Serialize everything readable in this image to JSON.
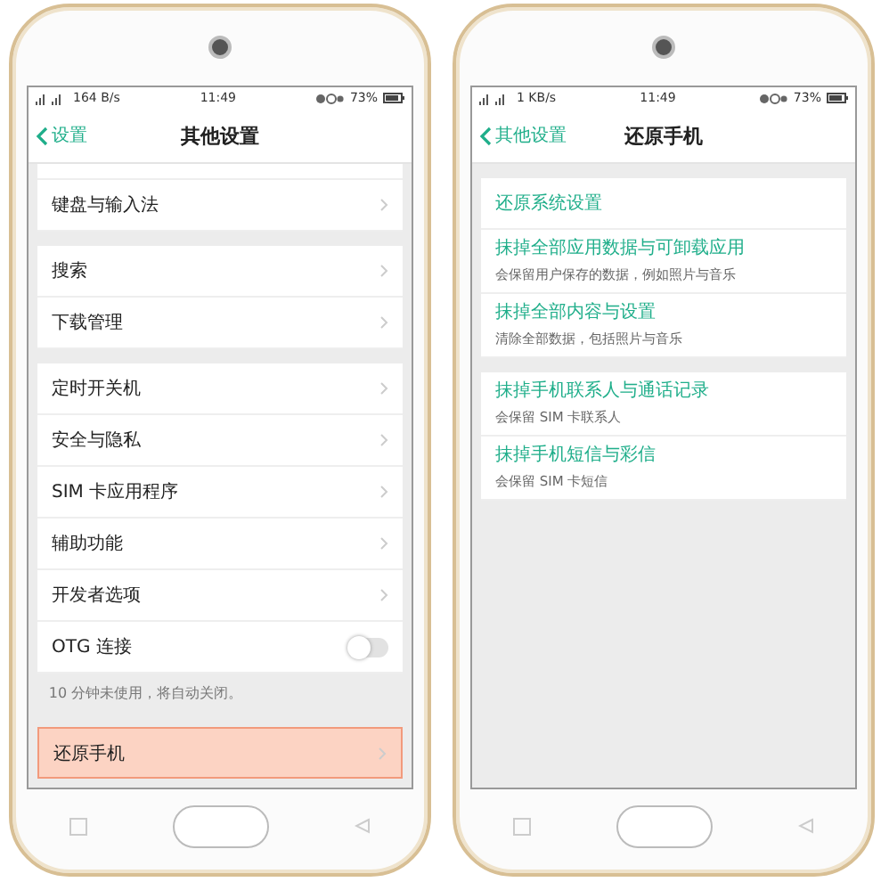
{
  "phones": [
    {
      "status": {
        "speed": "164 B/s",
        "time": "11:49",
        "battery": "73%"
      },
      "back": "设置",
      "title": "其他设置",
      "cut_top": true,
      "sections": [
        {
          "rows": [
            {
              "kind": "link",
              "label": "键盘与输入法",
              "highlighted": false
            }
          ]
        },
        {
          "rows": [
            {
              "kind": "link",
              "label": "搜索",
              "highlighted": false
            },
            {
              "kind": "link",
              "label": "下载管理",
              "highlighted": false
            }
          ]
        },
        {
          "rows": [
            {
              "kind": "link",
              "label": "定时开关机",
              "highlighted": false
            },
            {
              "kind": "link",
              "label": "安全与隐私",
              "highlighted": false
            },
            {
              "kind": "link",
              "label": "SIM 卡应用程序",
              "highlighted": false
            },
            {
              "kind": "link",
              "label": "辅助功能",
              "highlighted": false
            },
            {
              "kind": "link",
              "label": "开发者选项",
              "highlighted": false
            },
            {
              "kind": "toggle",
              "label": "OTG 连接",
              "on": false,
              "highlighted": false
            }
          ],
          "note": "10 分钟未使用，将自动关闭。"
        },
        {
          "rows": [
            {
              "kind": "link",
              "label": "还原手机",
              "highlighted": true
            }
          ]
        }
      ]
    },
    {
      "status": {
        "speed": "1 KB/s",
        "time": "11:49",
        "battery": "73%"
      },
      "back": "其他设置",
      "title": "还原手机",
      "cut_top": false,
      "sections": [
        {
          "rows": [
            {
              "kind": "action",
              "label": "还原系统设置",
              "highlighted": false
            },
            {
              "kind": "action",
              "label": "抹掉全部应用数据与可卸载应用",
              "sub": "会保留用户保存的数据，例如照片与音乐",
              "highlighted": false
            },
            {
              "kind": "action",
              "label": "抹掉全部内容与设置",
              "sub": "清除全部数据，包括照片与音乐",
              "highlighted": false
            }
          ]
        },
        {
          "rows": [
            {
              "kind": "action",
              "label": "抹掉手机联系人与通话记录",
              "sub": "会保留 SIM 卡联系人",
              "highlighted": false
            },
            {
              "kind": "action",
              "label": "抹掉手机短信与彩信",
              "sub": "会保留 SIM 卡短信",
              "highlighted": false
            }
          ]
        }
      ]
    }
  ]
}
